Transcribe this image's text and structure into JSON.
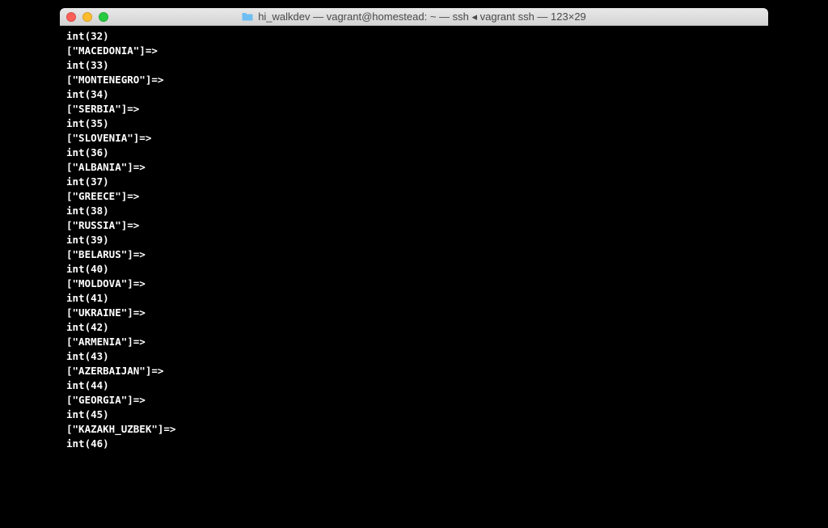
{
  "title": "hi_walkdev — vagrant@homestead: ~ — ssh ◂ vagrant ssh — 123×29",
  "lines": [
    "int(32)",
    "[\"MACEDONIA\"]=>",
    "int(33)",
    "[\"MONTENEGRO\"]=>",
    "int(34)",
    "[\"SERBIA\"]=>",
    "int(35)",
    "[\"SLOVENIA\"]=>",
    "int(36)",
    "[\"ALBANIA\"]=>",
    "int(37)",
    "[\"GREECE\"]=>",
    "int(38)",
    "[\"RUSSIA\"]=>",
    "int(39)",
    "[\"BELARUS\"]=>",
    "int(40)",
    "[\"MOLDOVA\"]=>",
    "int(41)",
    "[\"UKRAINE\"]=>",
    "int(42)",
    "[\"ARMENIA\"]=>",
    "int(43)",
    "[\"AZERBAIJAN\"]=>",
    "int(44)",
    "[\"GEORGIA\"]=>",
    "int(45)",
    "[\"KAZAKH_UZBEK\"]=>",
    "int(46)"
  ]
}
